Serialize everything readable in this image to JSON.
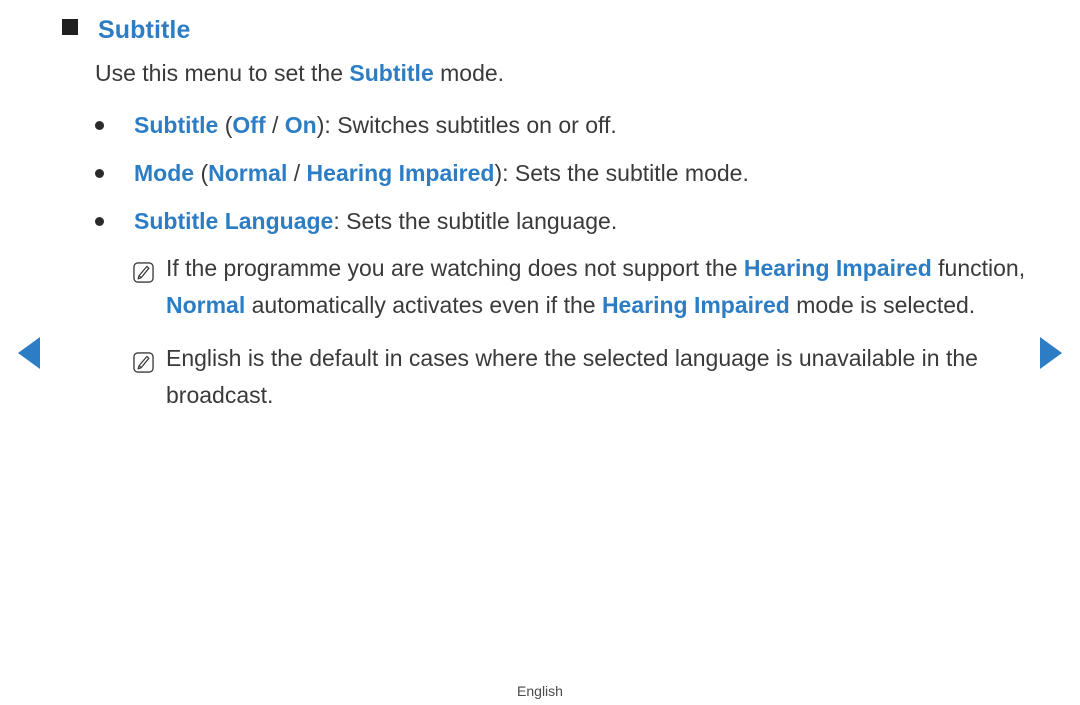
{
  "page": {
    "background_color": "#ffffff",
    "accent_color": "#2d7dc4",
    "text_color": "#3a3a3a"
  },
  "heading": {
    "marker": "square-marker",
    "title": "Subtitle"
  },
  "intro": {
    "before": "Use this menu to set the ",
    "highlight": "Subtitle",
    "after": " mode."
  },
  "bullets": [
    {
      "name": "subtitle",
      "parts": [
        {
          "text": "Subtitle",
          "style": "blue"
        },
        {
          "text": " (",
          "style": "dark"
        },
        {
          "text": "Off",
          "style": "blue"
        },
        {
          "text": " / ",
          "style": "dark"
        },
        {
          "text": "On",
          "style": "blue"
        },
        {
          "text": "): Switches subtitles on or off.",
          "style": "dark"
        }
      ]
    },
    {
      "name": "mode",
      "parts": [
        {
          "text": "Mode",
          "style": "blue"
        },
        {
          "text": " (",
          "style": "dark"
        },
        {
          "text": "Normal",
          "style": "blue"
        },
        {
          "text": " / ",
          "style": "dark"
        },
        {
          "text": "Hearing Impaired",
          "style": "blue"
        },
        {
          "text": "): Sets the subtitle mode.",
          "style": "dark"
        }
      ]
    },
    {
      "name": "subtitle-language",
      "parts": [
        {
          "text": "Subtitle Language",
          "style": "blue"
        },
        {
          "text": ": Sets the subtitle language.",
          "style": "dark"
        }
      ]
    }
  ],
  "notes": [
    {
      "name": "hearing-impaired-fallback",
      "icon": "note-pencil-icon",
      "parts": [
        {
          "text": "If the programme you are watching does not support the ",
          "style": "dark"
        },
        {
          "text": "Hearing Impaired",
          "style": "blue"
        },
        {
          "text": " function, ",
          "style": "dark"
        },
        {
          "text": "Normal",
          "style": "blue"
        },
        {
          "text": " automatically activates even if the ",
          "style": "dark"
        },
        {
          "text": "Hearing Impaired",
          "style": "blue"
        },
        {
          "text": " mode is selected.",
          "style": "dark"
        }
      ]
    },
    {
      "name": "english-default",
      "icon": "note-pencil-icon",
      "parts": [
        {
          "text": "English is the default in cases where the selected language is unavailable in the broadcast.",
          "style": "dark"
        }
      ]
    }
  ],
  "navigation": {
    "prev_label": "prev-arrow",
    "next_label": "next-arrow"
  },
  "footer": {
    "language": "English"
  }
}
